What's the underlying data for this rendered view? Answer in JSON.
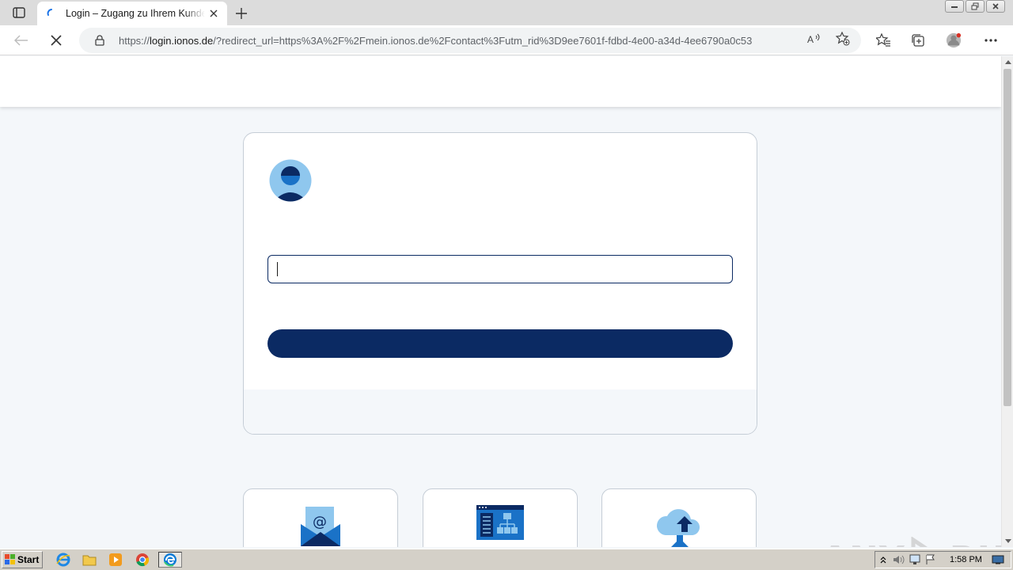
{
  "browser": {
    "tab": {
      "title": "Login – Zugang zu Ihrem Kundencenter",
      "favicon": "ionos-loading-icon"
    },
    "url": {
      "scheme": "https://",
      "host": "login.ionos.de",
      "path": "/?redirect_url=https%3A%2F%2Fmein.ionos.de%2Fcontact%3Futm_rid%3D9ee7601f-fdbd-4e00-a34d-4ee6790a0c53"
    }
  },
  "page": {
    "login_input": {
      "value": "",
      "placeholder": ""
    },
    "login_button": {
      "label": ""
    }
  },
  "colors": {
    "brand_navy": "#0b2a63",
    "avatar_light": "#8fc7ee",
    "avatar_dark": "#0b2a63",
    "page_bg": "#f4f7fa"
  },
  "watermark": {
    "text_left": "ANY",
    "text_right": "RUN"
  },
  "taskbar": {
    "start_label": "Start",
    "clock": "1:58 PM"
  }
}
